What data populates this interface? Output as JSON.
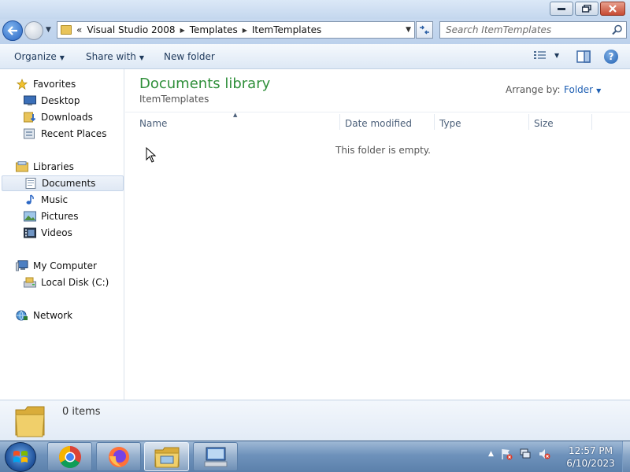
{
  "window": {
    "controls": {
      "minimize_icon": "minimize-icon",
      "maximize_icon": "maximize-icon",
      "close_icon": "close-icon"
    }
  },
  "address": {
    "overflow": "«",
    "breadcrumbs": [
      "Visual Studio 2008",
      "Templates",
      "ItemTemplates"
    ]
  },
  "search": {
    "placeholder": "Search ItemTemplates"
  },
  "toolbar": {
    "organize": "Organize",
    "share_with": "Share with",
    "new_folder": "New folder",
    "help": "?"
  },
  "nav": {
    "favorites": "Favorites",
    "desktop": "Desktop",
    "downloads": "Downloads",
    "recent_places": "Recent Places",
    "libraries": "Libraries",
    "documents": "Documents",
    "music": "Music",
    "pictures": "Pictures",
    "videos": "Videos",
    "my_computer": "My Computer",
    "local_disk": "Local Disk (C:)",
    "network": "Network"
  },
  "library": {
    "title": "Documents library",
    "subtitle": "ItemTemplates",
    "arrange_label": "Arrange by:",
    "arrange_value": "Folder"
  },
  "columns": {
    "name": "Name",
    "date_modified": "Date modified",
    "type": "Type",
    "size": "Size"
  },
  "empty_message": "This folder is empty.",
  "details": {
    "item_count": "0 items"
  },
  "taskbar": {
    "apps": [
      "chrome-icon",
      "firefox-icon",
      "explorer-icon",
      "remote-desktop-icon"
    ],
    "clock_time": "12:57 PM",
    "clock_date": "6/10/2023"
  },
  "colors": {
    "title_green": "#2f8f3a",
    "link_blue": "#1e5fb3",
    "toolbar_text": "#1e395b",
    "taskbar_blue": "#6e92bb"
  }
}
